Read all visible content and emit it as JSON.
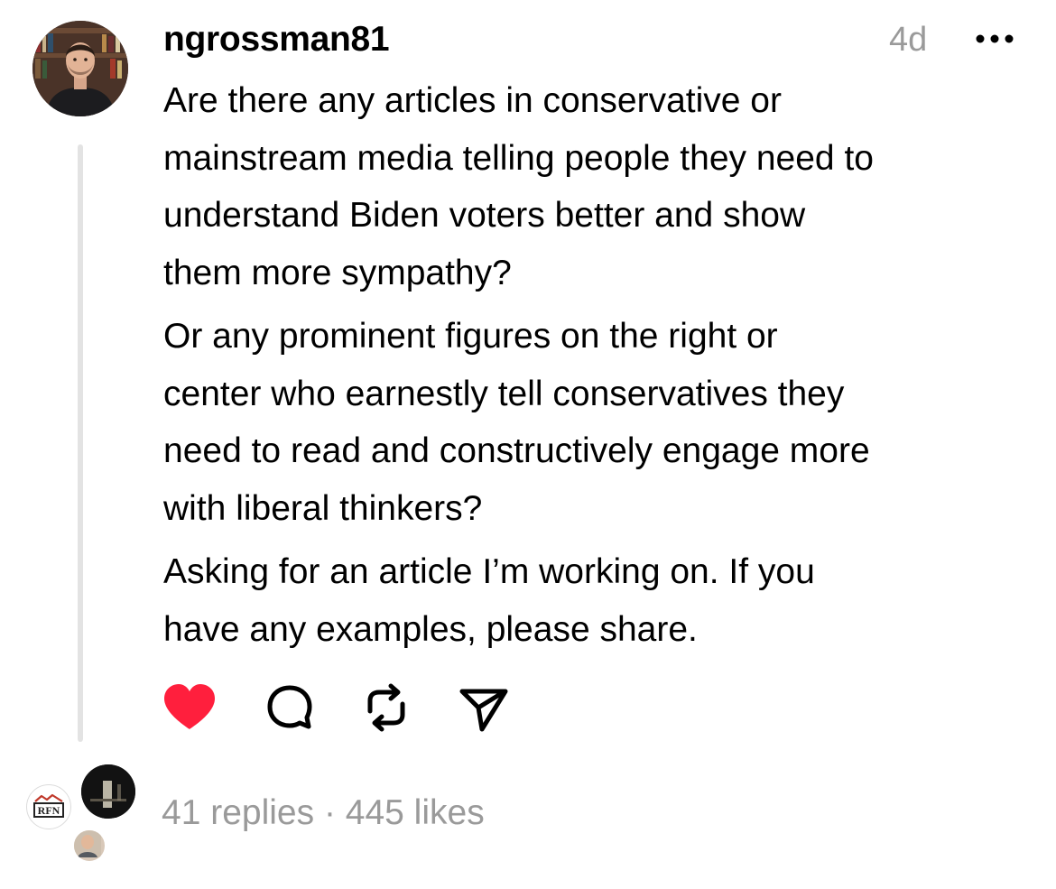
{
  "post": {
    "username": "ngrossman81",
    "timestamp": "4d",
    "paragraphs": [
      "Are there any articles in conservative or\nmainstream media telling people they need to\nunderstand Biden voters better and show\nthem more sympathy?",
      "Or any prominent figures on the right or\ncenter who earnestly tell conservatives they\nneed to read and constructively engage more\nwith liberal thinkers?",
      "Asking for an article I’m working on. If you\nhave any examples, please share."
    ],
    "liked": true,
    "accent_like_color": "#ff1f3d",
    "text_color": "#000000",
    "muted_color": "#9a9a9a"
  },
  "icons": {
    "more": "more-icon",
    "like": "heart-icon",
    "reply": "comment-icon",
    "repost": "repost-icon",
    "share": "send-icon"
  },
  "footer": {
    "replies": "41 replies",
    "separator": " · ",
    "likes": "445 likes",
    "reply_avatar_logo_text": "RFN"
  }
}
